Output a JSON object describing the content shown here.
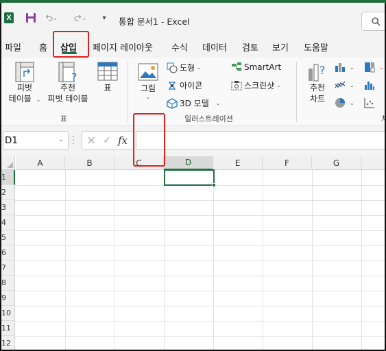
{
  "app": {
    "title": "통합 문서1  -  Excel",
    "logo_letter": "X"
  },
  "qat": {
    "save_icon": "save-icon",
    "undo_icon": "undo-icon",
    "redo_icon": "redo-icon",
    "more": "▾"
  },
  "search": {
    "icon": "search-icon"
  },
  "tabs": [
    {
      "label": "파일"
    },
    {
      "label": "홈"
    },
    {
      "label": "삽입",
      "active": true
    },
    {
      "label": "페이지 레이아웃"
    },
    {
      "label": "수식"
    },
    {
      "label": "데이터"
    },
    {
      "label": "검토"
    },
    {
      "label": "보기"
    },
    {
      "label": "도움말"
    }
  ],
  "ribbon": {
    "tables": {
      "pivot_label1": "피벗",
      "pivot_label2": "테이블",
      "recommended_pivot_label1": "추천",
      "recommended_pivot_label2": "피벗 테이블",
      "table_label": "표",
      "group_label": "표"
    },
    "illustrations": {
      "pictures_label": "그림",
      "shapes_label": "도형",
      "icons_label": "아이콘",
      "models3d_label": "3D 모델",
      "smartart_label": "SmartArt",
      "screenshot_label": "스크린샷",
      "group_label": "일러스트레이션"
    },
    "charts": {
      "recommended_label1": "추천",
      "recommended_label2": "차트",
      "group_label_partial": "차"
    }
  },
  "formula_bar": {
    "name_box": "D1",
    "fx": "fx",
    "cancel_icon": "×",
    "enter_icon": "✓",
    "value": ""
  },
  "grid": {
    "columns": [
      "A",
      "B",
      "C",
      "D",
      "E",
      "F",
      "G"
    ],
    "rows": [
      "1",
      "2",
      "3",
      "4",
      "5",
      "6",
      "7",
      "8",
      "9",
      "10",
      "11",
      "12"
    ],
    "selected_cell": "D1",
    "selected_col": "D",
    "selected_row": "1"
  },
  "colors": {
    "accent": "#1e6e3c",
    "highlight": "#e01e1e"
  }
}
